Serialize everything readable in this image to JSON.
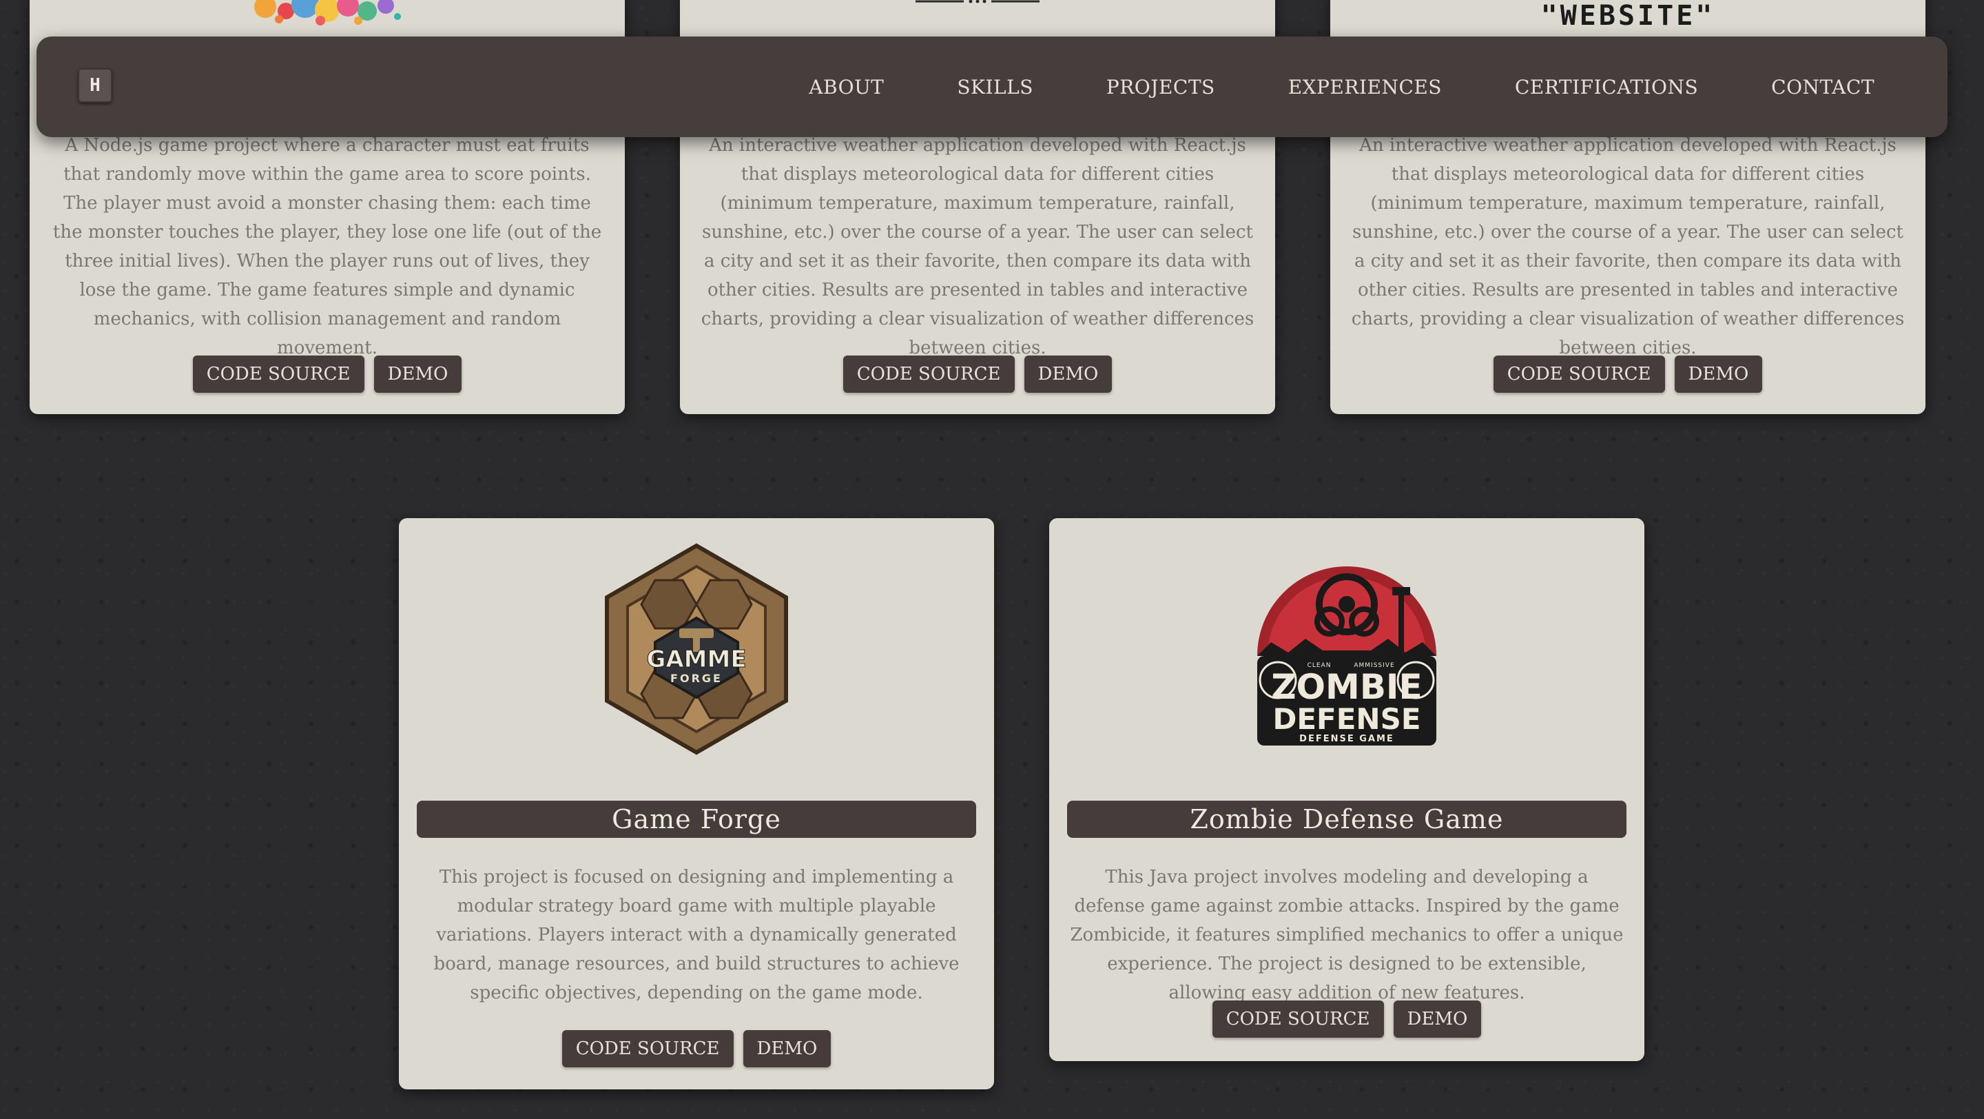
{
  "navbar": {
    "brand": "H",
    "links": [
      "ABOUT",
      "SKILLS",
      "PROJECTS",
      "EXPERIENCES",
      "CERTIFICATIONS",
      "CONTACT"
    ]
  },
  "projects_top": [
    {
      "image_text": "",
      "description": "A Node.js game project where a character must eat fruits that randomly move within the game area to score points. The player must avoid a monster chasing them: each time the monster touches the player, they lose one life (out of the three initial lives). When the player runs out of lives, they lose the game. The game features simple and dynamic mechanics, with collision management and random movement.",
      "code_source_label": "CODE SOURCE",
      "demo_label": "DEMO"
    },
    {
      "image_text": "",
      "description": "An interactive weather application developed with React.js that displays meteorological data for different cities (minimum temperature, maximum temperature, rainfall, sunshine, etc.) over the course of a year. The user can select a city and set it as their favorite, then compare its data with other cities. Results are presented in tables and interactive charts, providing a clear visualization of weather differences between cities.",
      "code_source_label": "CODE SOURCE",
      "demo_label": "DEMO"
    },
    {
      "image_text": "\"WEBSITE\"",
      "description": "An interactive weather application developed with React.js that displays meteorological data for different cities (minimum temperature, maximum temperature, rainfall, sunshine, etc.) over the course of a year. The user can select a city and set it as their favorite, then compare its data with other cities. Results are presented in tables and interactive charts, providing a clear visualization of weather differences between cities.",
      "code_source_label": "CODE SOURCE",
      "demo_label": "DEMO"
    }
  ],
  "projects_bottom": [
    {
      "title": "Game Forge",
      "logo_text": [
        "GAMME",
        "FORGE"
      ],
      "description": "This project is focused on designing and implementing a modular strategy board game with multiple playable variations. Players interact with a dynamically generated board, manage resources, and build structures to achieve specific objectives, depending on the game mode.",
      "code_source_label": "CODE SOURCE",
      "demo_label": "DEMO"
    },
    {
      "title": "Zombie Defense Game",
      "logo_text": [
        "ZOMBIE",
        "DEFENSE",
        "DEFENSE GAME",
        "CLEAN",
        "AMMISSIVE"
      ],
      "description": "This Java project involves modeling and developing a defense game against zombie attacks. Inspired by the game Zombicide, it features simplified mechanics to offer a unique experience. The project is designed to be extensible, allowing easy addition of new features.",
      "code_source_label": "CODE SOURCE",
      "demo_label": "DEMO"
    }
  ],
  "colors": {
    "background": "#2b2a2c",
    "card": "#dcdad0",
    "accent": "#463c3b",
    "text_muted": "#7a7772",
    "button_text": "#e8e3da"
  }
}
